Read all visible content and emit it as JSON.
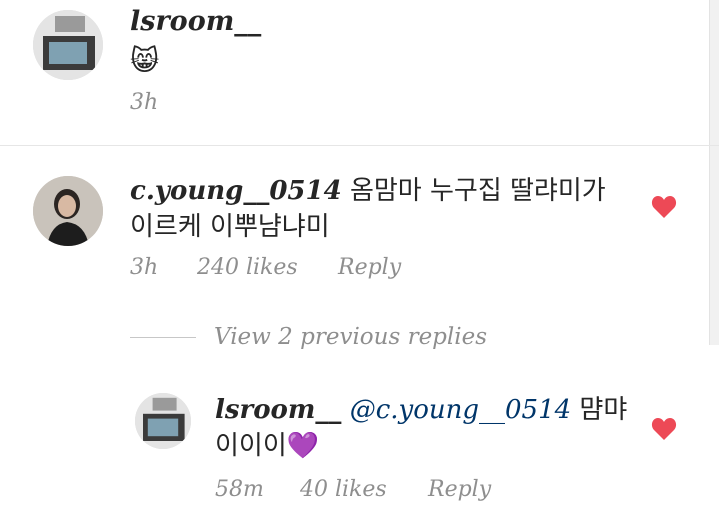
{
  "comments": [
    {
      "username": "lsroom__",
      "emoji": "😸",
      "time": "3h"
    },
    {
      "username": "c.young__0514",
      "text_line1": "옴맘마 누구집 딸랴미가",
      "text_line2": "이르케 이뿌냠냐미",
      "time": "3h",
      "likes": "240 likes",
      "reply": "Reply"
    }
  ],
  "view_replies": "View 2 previous replies",
  "reply": {
    "username": "lsroom__",
    "mention": "@c.young__0514",
    "text_line1": "먐먀",
    "text_line2": "이이이",
    "emoji": "💜",
    "time": "58m",
    "likes": "40 likes",
    "reply": "Reply"
  },
  "colors": {
    "heart": "#ed4956",
    "mention": "#003569",
    "muted": "#8e8e8e"
  },
  "icons": [
    "heart-icon"
  ]
}
